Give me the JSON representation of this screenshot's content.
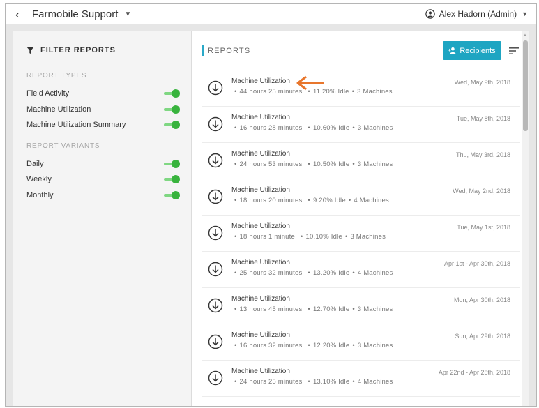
{
  "topbar": {
    "title": "Farmobile Support",
    "user_name": "Alex Hadorn (Admin)"
  },
  "sidebar": {
    "title": "FILTER REPORTS",
    "report_types_label": "REPORT TYPES",
    "report_types": [
      {
        "label": "Field Activity",
        "enabled": true
      },
      {
        "label": "Machine Utilization",
        "enabled": true
      },
      {
        "label": "Machine Utilization Summary",
        "enabled": true
      }
    ],
    "report_variants_label": "REPORT VARIANTS",
    "report_variants": [
      {
        "label": "Daily",
        "enabled": true
      },
      {
        "label": "Weekly",
        "enabled": true
      },
      {
        "label": "Monthly",
        "enabled": true
      }
    ]
  },
  "main": {
    "title": "REPORTS",
    "recipients_label": "Recipients",
    "reports": [
      {
        "title": "Machine Utilization",
        "hours": "44 hours 25 minutes",
        "idle": "11.20% Idle",
        "machines": "3 Machines",
        "date": "Wed, May 9th, 2018"
      },
      {
        "title": "Machine Utilization",
        "hours": "16 hours 28 minutes",
        "idle": "10.60% Idle",
        "machines": "3 Machines",
        "date": "Tue, May 8th, 2018"
      },
      {
        "title": "Machine Utilization",
        "hours": "24 hours 53 minutes",
        "idle": "10.50% Idle",
        "machines": "3 Machines",
        "date": "Thu, May 3rd, 2018"
      },
      {
        "title": "Machine Utilization",
        "hours": "18 hours 20 minutes",
        "idle": "9.20% Idle",
        "machines": "4 Machines",
        "date": "Wed, May 2nd, 2018"
      },
      {
        "title": "Machine Utilization",
        "hours": "18 hours 1 minute",
        "idle": "10.10% Idle",
        "machines": "3 Machines",
        "date": "Tue, May 1st, 2018"
      },
      {
        "title": "Machine Utilization",
        "hours": "25 hours 32 minutes",
        "idle": "13.20% Idle",
        "machines": "4 Machines",
        "date": "Apr 1st - Apr 30th, 2018"
      },
      {
        "title": "Machine Utilization",
        "hours": "13 hours 45 minutes",
        "idle": "12.70% Idle",
        "machines": "3 Machines",
        "date": "Mon, Apr 30th, 2018"
      },
      {
        "title": "Machine Utilization",
        "hours": "16 hours 32 minutes",
        "idle": "12.20% Idle",
        "machines": "3 Machines",
        "date": "Sun, Apr 29th, 2018"
      },
      {
        "title": "Machine Utilization",
        "hours": "24 hours 25 minutes",
        "idle": "13.10% Idle",
        "machines": "4 Machines",
        "date": "Apr 22nd - Apr 28th, 2018"
      }
    ]
  },
  "colors": {
    "accent": "#1ea5c2",
    "toggle_on": "#38b33d",
    "annotation_arrow": "#e8762c"
  },
  "icons": {
    "back": "chevron-left-icon",
    "dropdown": "caret-down-icon",
    "user": "user-circle-icon",
    "filter": "filter-icon",
    "recipients": "add-person-icon",
    "sort": "sort-lines-icon",
    "download": "download-circle-icon"
  }
}
